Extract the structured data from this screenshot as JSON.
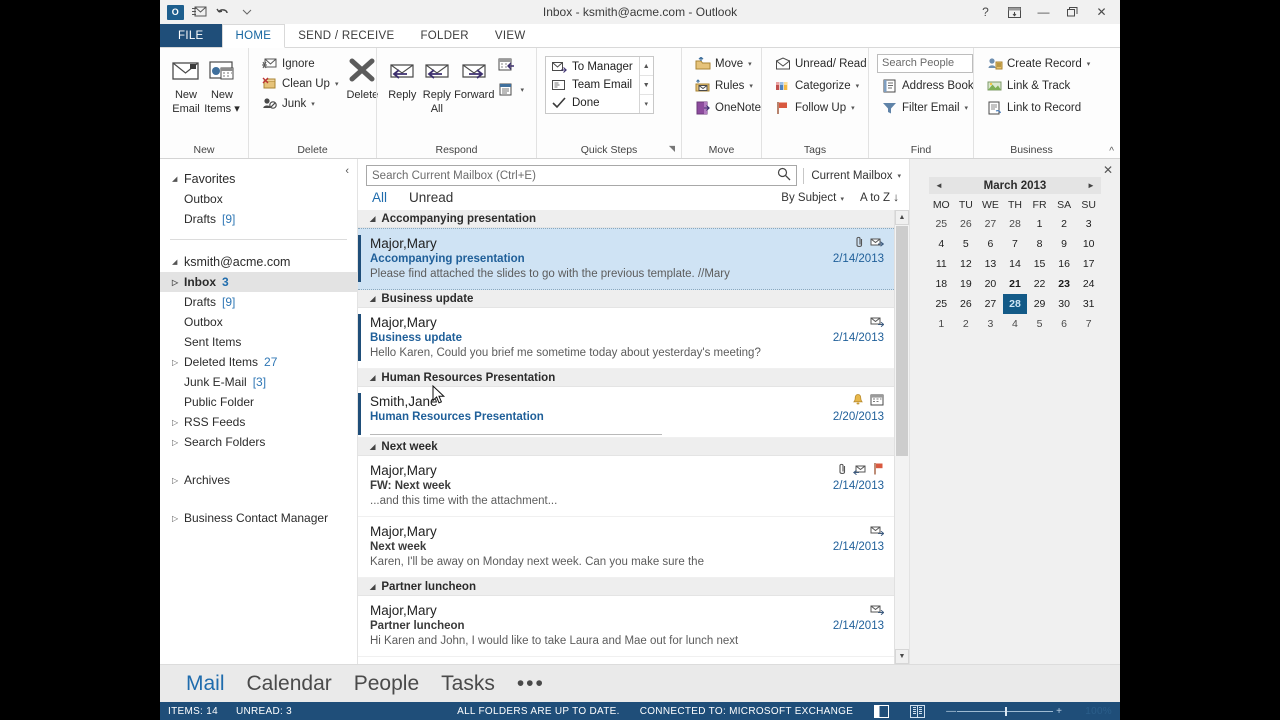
{
  "window": {
    "title": "Inbox - ksmith@acme.com - Outlook",
    "logo_text": "O",
    "controls": {
      "help": "?",
      "ribbon_options": "▣",
      "minimize": "—",
      "restore": "❐",
      "close": "✕"
    },
    "quick_access": [
      "outlook-logo",
      "send-receive-icon",
      "undo-icon",
      "customize-qat-icon"
    ]
  },
  "ribbon": {
    "tabs": [
      {
        "label": "FILE",
        "active": false,
        "kind": "file"
      },
      {
        "label": "HOME",
        "active": true,
        "kind": "normal"
      },
      {
        "label": "SEND / RECEIVE",
        "active": false,
        "kind": "normal"
      },
      {
        "label": "FOLDER",
        "active": false,
        "kind": "normal"
      },
      {
        "label": "VIEW",
        "active": false,
        "kind": "normal"
      }
    ],
    "groups": {
      "new": {
        "label": "New",
        "buttons": [
          {
            "line1": "New",
            "line2": "Email"
          },
          {
            "line1": "New",
            "line2": "Items ▾"
          }
        ]
      },
      "delete": {
        "label": "Delete",
        "small": [
          {
            "label": "Ignore",
            "caret": false
          },
          {
            "label": "Clean Up",
            "caret": true
          },
          {
            "label": "Junk",
            "caret": true
          }
        ],
        "big": {
          "line1": "Delete",
          "line2": ""
        }
      },
      "respond": {
        "label": "Respond",
        "buttons": [
          {
            "line1": "Reply",
            "line2": ""
          },
          {
            "line1": "Reply",
            "line2": "All"
          },
          {
            "line1": "Forward",
            "line2": ""
          }
        ],
        "extra": [
          "meeting-icon",
          "more-respond-icon"
        ]
      },
      "quick_steps": {
        "label": "Quick Steps",
        "items": [
          "To Manager",
          "Team Email",
          "Done"
        ],
        "dialog_launcher": "◥"
      },
      "move": {
        "label": "Move",
        "items": [
          {
            "label": "Move",
            "caret": true
          },
          {
            "label": "Rules",
            "caret": true
          },
          {
            "label": "OneNote",
            "caret": false
          }
        ]
      },
      "tags": {
        "label": "Tags",
        "items": [
          {
            "label": "Unread/ Read",
            "caret": false
          },
          {
            "label": "Categorize",
            "caret": true
          },
          {
            "label": "Follow Up",
            "caret": true
          }
        ]
      },
      "find": {
        "label": "Find",
        "search_placeholder": "Search People",
        "items": [
          {
            "label": "Address Book",
            "caret": false
          },
          {
            "label": "Filter Email",
            "caret": true
          }
        ]
      },
      "business": {
        "label": "Business",
        "items": [
          {
            "label": "Create Record",
            "caret": true
          },
          {
            "label": "Link & Track",
            "caret": false
          },
          {
            "label": "Link to Record",
            "caret": false
          }
        ]
      }
    },
    "collapse_icon": "^"
  },
  "folder_pane": {
    "collapse_icon": "‹",
    "favorites": {
      "label": "Favorites",
      "items": [
        {
          "label": "Outbox",
          "count": ""
        },
        {
          "label": "Drafts",
          "count": "[9]"
        }
      ]
    },
    "account": {
      "label": "ksmith@acme.com",
      "items": [
        {
          "label": "Inbox",
          "count": "3",
          "expandable": true,
          "selected": true
        },
        {
          "label": "Drafts",
          "count": "[9]",
          "expandable": false,
          "selected": false
        },
        {
          "label": "Outbox",
          "count": "",
          "expandable": false,
          "selected": false
        },
        {
          "label": "Sent Items",
          "count": "",
          "expandable": false,
          "selected": false
        },
        {
          "label": "Deleted Items",
          "count": "27",
          "expandable": true,
          "selected": false
        },
        {
          "label": "Junk E-Mail",
          "count": "[3]",
          "expandable": false,
          "selected": false
        },
        {
          "label": "Public Folder",
          "count": "",
          "expandable": false,
          "selected": false
        },
        {
          "label": "RSS Feeds",
          "count": "",
          "expandable": true,
          "selected": false
        },
        {
          "label": "Search Folders",
          "count": "",
          "expandable": true,
          "selected": false
        }
      ]
    },
    "extra": [
      {
        "label": "Archives"
      },
      {
        "label": "Business Contact Manager"
      }
    ]
  },
  "message_list": {
    "search": {
      "placeholder": "Search Current Mailbox (Ctrl+E)",
      "value": "",
      "scope": "Current Mailbox"
    },
    "filters": [
      {
        "label": "All",
        "active": true
      },
      {
        "label": "Unread",
        "active": false
      }
    ],
    "sort": {
      "group_by": "By Subject",
      "order": "A to Z"
    },
    "groups": [
      {
        "name": "Accompanying presentation",
        "messages": [
          {
            "from": "Major,Mary",
            "subject": "Accompanying presentation",
            "preview": "Please find attached the slides to go with the previous template.  //Mary",
            "date": "2/14/2013",
            "icons": [
              "attachment-icon",
              "replied-icon"
            ],
            "unread": true,
            "selected": true
          }
        ]
      },
      {
        "name": "Business update",
        "messages": [
          {
            "from": "Major,Mary",
            "subject": "Business update",
            "preview": "Hello Karen,  Could you brief me sometime today about yesterday's meeting?",
            "date": "2/14/2013",
            "icons": [
              "forwarded-icon"
            ],
            "unread": true,
            "selected": false
          }
        ]
      },
      {
        "name": "Human Resources Presentation",
        "messages": [
          {
            "from": "Smith,Jane",
            "subject": "Human Resources Presentation",
            "preview": "",
            "date": "2/20/2013",
            "icons": [
              "reminder-bell-icon",
              "meeting-calendar-icon"
            ],
            "unread": true,
            "selected": false,
            "meeting": true
          }
        ]
      },
      {
        "name": "Next week",
        "messages": [
          {
            "from": "Major,Mary",
            "subject": "FW: Next week",
            "preview": "...and this time with the attachment...",
            "date": "2/14/2013",
            "icons": [
              "attachment-icon",
              "replied-icon",
              "flag-icon"
            ],
            "unread": false,
            "selected": false
          },
          {
            "from": "Major,Mary",
            "subject": "Next week",
            "preview": "Karen,  I'll be away on Monday next week. Can you make sure the",
            "date": "2/14/2013",
            "icons": [
              "forwarded-icon"
            ],
            "unread": false,
            "selected": false
          }
        ]
      },
      {
        "name": "Partner luncheon",
        "messages": [
          {
            "from": "Major,Mary",
            "subject": "Partner luncheon",
            "preview": "Hi Karen and John,  I would like to take Laura and Mae out for lunch next",
            "date": "2/14/2013",
            "icons": [
              "forwarded-icon"
            ],
            "unread": false,
            "selected": false
          }
        ]
      }
    ]
  },
  "calendar_peek": {
    "close_icon": "✕",
    "prev_icon": "◄",
    "next_icon": "►",
    "month_title": "March 2013",
    "weekdays": [
      "MO",
      "TU",
      "WE",
      "TH",
      "FR",
      "SA",
      "SU"
    ],
    "weeks": [
      [
        {
          "d": "25",
          "m": "prev"
        },
        {
          "d": "26",
          "m": "prev"
        },
        {
          "d": "27",
          "m": "prev"
        },
        {
          "d": "28",
          "m": "prev"
        },
        {
          "d": "1",
          "m": "cur"
        },
        {
          "d": "2",
          "m": "cur"
        },
        {
          "d": "3",
          "m": "cur"
        }
      ],
      [
        {
          "d": "4",
          "m": "cur"
        },
        {
          "d": "5",
          "m": "cur"
        },
        {
          "d": "6",
          "m": "cur"
        },
        {
          "d": "7",
          "m": "cur"
        },
        {
          "d": "8",
          "m": "cur"
        },
        {
          "d": "9",
          "m": "cur"
        },
        {
          "d": "10",
          "m": "cur"
        }
      ],
      [
        {
          "d": "11",
          "m": "cur"
        },
        {
          "d": "12",
          "m": "cur"
        },
        {
          "d": "13",
          "m": "cur"
        },
        {
          "d": "14",
          "m": "cur"
        },
        {
          "d": "15",
          "m": "cur"
        },
        {
          "d": "16",
          "m": "cur"
        },
        {
          "d": "17",
          "m": "cur"
        }
      ],
      [
        {
          "d": "18",
          "m": "cur"
        },
        {
          "d": "19",
          "m": "cur"
        },
        {
          "d": "20",
          "m": "cur"
        },
        {
          "d": "21",
          "m": "bold"
        },
        {
          "d": "22",
          "m": "cur"
        },
        {
          "d": "23",
          "m": "bold"
        },
        {
          "d": "24",
          "m": "cur"
        }
      ],
      [
        {
          "d": "25",
          "m": "cur"
        },
        {
          "d": "26",
          "m": "cur"
        },
        {
          "d": "27",
          "m": "cur"
        },
        {
          "d": "28",
          "m": "today"
        },
        {
          "d": "29",
          "m": "cur"
        },
        {
          "d": "30",
          "m": "cur"
        },
        {
          "d": "31",
          "m": "cur"
        }
      ],
      [
        {
          "d": "1",
          "m": "next"
        },
        {
          "d": "2",
          "m": "next"
        },
        {
          "d": "3",
          "m": "next"
        },
        {
          "d": "4",
          "m": "next"
        },
        {
          "d": "5",
          "m": "next"
        },
        {
          "d": "6",
          "m": "next"
        },
        {
          "d": "7",
          "m": "next"
        }
      ]
    ]
  },
  "nav_bar": {
    "items": [
      {
        "label": "Mail",
        "active": true
      },
      {
        "label": "Calendar",
        "active": false
      },
      {
        "label": "People",
        "active": false
      },
      {
        "label": "Tasks",
        "active": false
      }
    ],
    "overflow": "•••"
  },
  "status_bar": {
    "items_count": "ITEMS: 14",
    "unread_count": "UNREAD: 3",
    "sync_status": "ALL FOLDERS ARE UP TO DATE.",
    "connection": "CONNECTED TO: MICROSOFT EXCHANGE",
    "view_normal_icon": "normal-view-icon",
    "view_reading_icon": "reading-view-icon",
    "zoom": {
      "minus": "—",
      "plus": "+",
      "value": "100%"
    }
  },
  "colors": {
    "accent": "#1f4e79",
    "link": "#1f5f99",
    "selection": "#cfe3f4",
    "today": "#135a87"
  }
}
